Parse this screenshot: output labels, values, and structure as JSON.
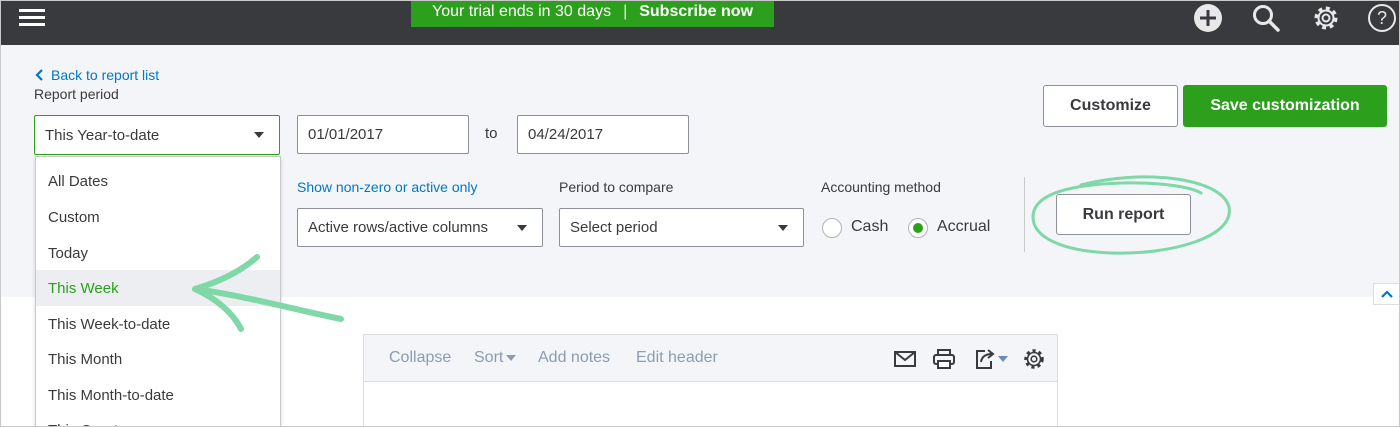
{
  "trial_banner": {
    "message": "Your trial ends in 30 days",
    "separator": "|",
    "cta": "Subscribe now"
  },
  "topbar_icons": [
    "hamburger-menu-icon",
    "plus-icon",
    "search-icon",
    "gear-icon",
    "help-icon"
  ],
  "back_link": "Back to report list",
  "report_period": {
    "label": "Report period",
    "selected": "This Year-to-date",
    "from": "01/01/2017",
    "to_label": "to",
    "to": "04/24/2017",
    "options": [
      "All Dates",
      "Custom",
      "Today",
      "This Week",
      "This Week-to-date",
      "This Month",
      "This Month-to-date",
      "This Quarter"
    ],
    "highlighted_index": 3
  },
  "buttons": {
    "customize": "Customize",
    "save_customization": "Save customization",
    "run_report": "Run report"
  },
  "filters": {
    "show_label": "Show non-zero or active only",
    "show_value": "Active rows/active columns",
    "compare_label": "Period to compare",
    "compare_value": "Select period",
    "method_label": "Accounting method",
    "cash": "Cash",
    "accrual": "Accrual",
    "selected_method": "Accrual"
  },
  "report_toolbar": {
    "collapse": "Collapse",
    "sort": "Sort",
    "add_notes": "Add notes",
    "edit_header": "Edit header"
  },
  "colors": {
    "brand_green": "#2ca01c",
    "topbar": "#393a3d",
    "link_blue": "#0077c5",
    "annotation": "#7ed8a8"
  }
}
